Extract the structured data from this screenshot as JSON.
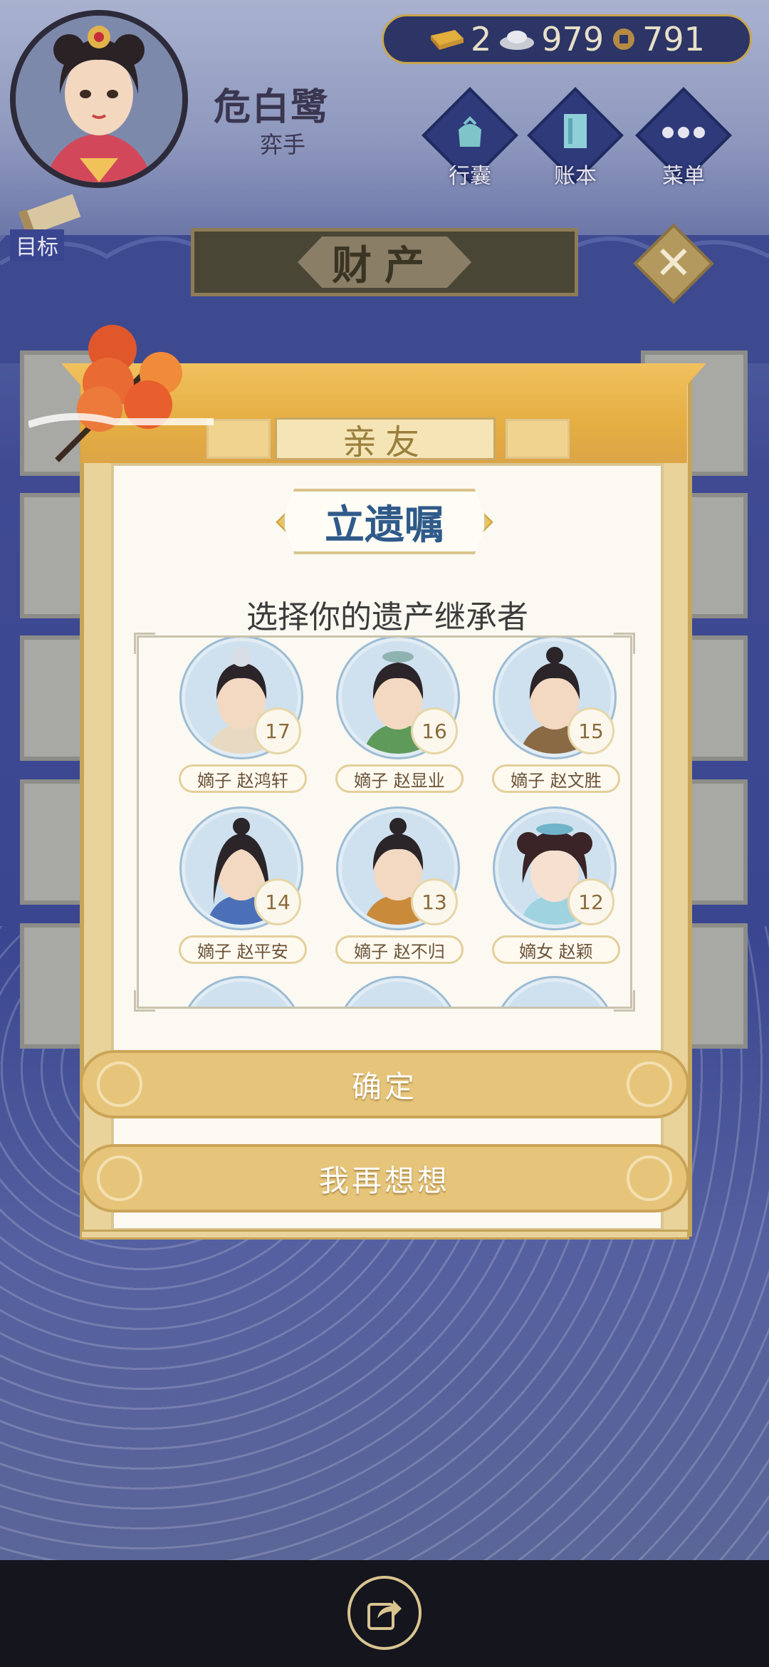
{
  "player": {
    "name": "危白鹭",
    "title": "弈手"
  },
  "currency": {
    "gold": "2",
    "silver": "979",
    "coins": "791"
  },
  "top_menu": [
    {
      "label": "行囊",
      "icon": "bag-icon"
    },
    {
      "label": "账本",
      "icon": "ledger-icon"
    },
    {
      "label": "菜单",
      "icon": "more-icon"
    }
  ],
  "goal": {
    "label": "目标",
    "icon": "scroll-icon"
  },
  "page": {
    "title": "财产"
  },
  "panel": {
    "tab_label": "亲友",
    "will_title": "立遗嘱",
    "subtitle": "选择你的遗产继承者"
  },
  "heirs": [
    {
      "label": "嫡子 赵鸿轩",
      "age": "17"
    },
    {
      "label": "嫡子 赵显业",
      "age": "16"
    },
    {
      "label": "嫡子 赵文胜",
      "age": "15"
    },
    {
      "label": "嫡子 赵平安",
      "age": "14"
    },
    {
      "label": "嫡子 赵不归",
      "age": "13"
    },
    {
      "label": "嫡女 赵颖",
      "age": "12"
    }
  ],
  "buttons": {
    "confirm": "确定",
    "reconsider": "我再想想"
  },
  "colors": {
    "background": "#3d4a8e",
    "panel_gold": "#e9d39a",
    "title_blue": "#2f5a8a",
    "button_gold": "#e6c57a"
  }
}
